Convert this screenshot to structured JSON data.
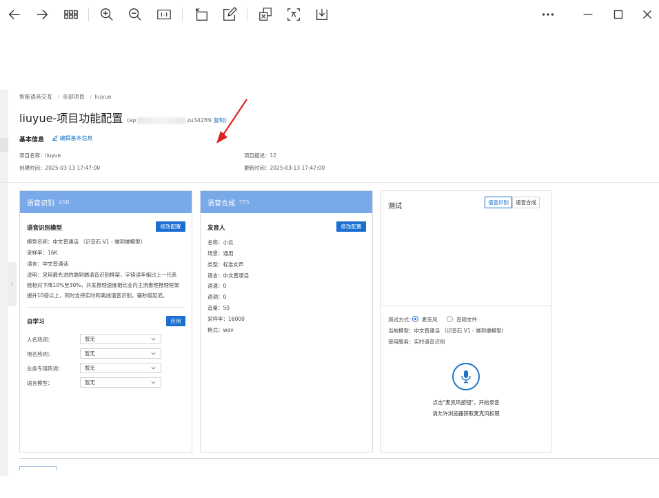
{
  "toolbar": {
    "icons": [
      "back-icon",
      "forward-icon",
      "grid-icon",
      "zoom-in-icon",
      "zoom-out-icon",
      "fit-icon",
      "rotate-icon",
      "edit-icon",
      "translate-image-icon",
      "translate-text-icon",
      "download-icon",
      "more-icon",
      "minimize-icon",
      "maximize-icon",
      "close-icon"
    ]
  },
  "breadcrumb": {
    "items": [
      "智能语音交互",
      "全部项目",
      "liuyue"
    ]
  },
  "header": {
    "title": "liuyue-项目功能配置",
    "appid_prefix": "(ap",
    "appid_suffix": "zu342ft9",
    "copy_label": "复制",
    "close_paren": ")"
  },
  "basic_info": {
    "title": "基本信息",
    "edit_label": "编辑基本信息",
    "project_name": "项目名称：liuyue",
    "created": "创建时间：2025-03-13 17:47:00",
    "description": "项目描述：12",
    "updated": "更新时间：2025-03-13 17:47:00"
  },
  "asr": {
    "title": "语音识别",
    "subtitle": "ASR",
    "model_title": "语音识别模型",
    "modify_label": "修改配置",
    "lines": [
      "模型名称：中文普通话 （识音石 V1 - 端到端模型）",
      "采样率：16K",
      "语言：中文普通话",
      "说明：采用最先进的端到端语音识别框架，字错误率相比上一代系",
      "统相对下降10%至30%，并发推理速度相比业内主流推理推理框架",
      "提升10倍以上，同时支持实时和离线语音识别，毫秒级延迟。"
    ],
    "self_learn_title": "自学习",
    "apply_label": "应用",
    "selects": [
      {
        "label": "人名热词：",
        "value": "暂无"
      },
      {
        "label": "地名热词：",
        "value": "暂无"
      },
      {
        "label": "业务专用热词：",
        "value": "暂无"
      },
      {
        "label": "语言模型：",
        "value": "暂无"
      }
    ]
  },
  "tts": {
    "title": "语音合成",
    "subtitle": "TTS",
    "speaker_title": "发音人",
    "modify_label": "修改配置",
    "lines": [
      "名称：小云",
      "场景：通用",
      "类型：标准女声",
      "语言：中文普通话",
      "语速：0",
      "语调：0",
      "音量：50",
      "采样率：16000",
      "格式：wav"
    ]
  },
  "test": {
    "title": "测试",
    "tabs": [
      "语音识别",
      "语音合成"
    ],
    "active_tab": 0,
    "mode_label": "测试方式：",
    "mode_options": [
      "麦克风",
      "音频文件"
    ],
    "mode_selected": 0,
    "model_line": "当前模型：中文普通话 （识音石 V1 - 端到端模型）",
    "service_line": "使用服务：实时语音识别",
    "hint1": "点击\"麦克风按钮\"，开始录音",
    "hint2": "请允许浏览器获取麦克风权限"
  },
  "colors": {
    "accent": "#1a6fd0",
    "card_header": "#7aa9ea",
    "arrow": "#e02020"
  }
}
